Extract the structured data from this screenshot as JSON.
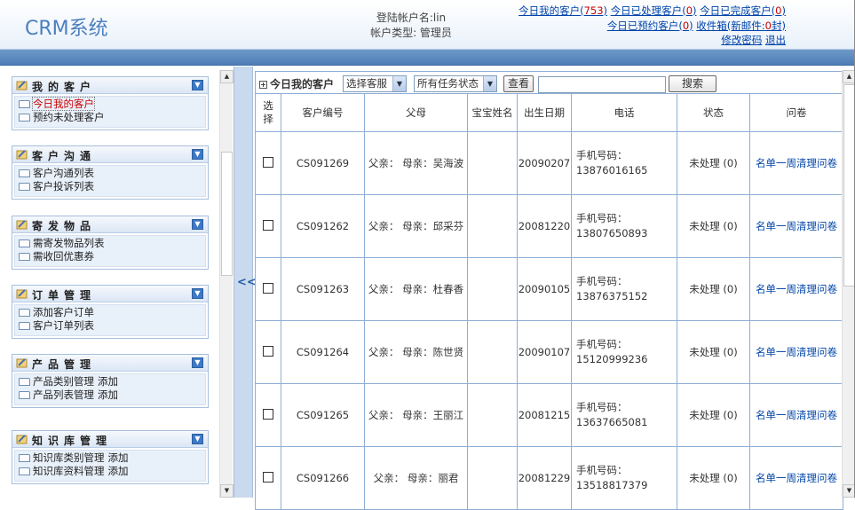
{
  "app": {
    "title": "CRM系统"
  },
  "login": {
    "account_line": "登陆帐户名:lin",
    "type_line": "帐户类型: 管理员"
  },
  "top_links": {
    "today_customers": {
      "label": "今日我的客户",
      "count": "753"
    },
    "today_handled": {
      "label": "今日已处理客户",
      "count": "0"
    },
    "today_done": {
      "label": "今日已完成客户",
      "count": "0"
    },
    "today_booked": {
      "label": "今日已预约客户",
      "count": "0"
    },
    "inbox": {
      "label": "收件箱(新邮件:",
      "count": "0",
      "suffix": "封)"
    },
    "change_password": "修改密码",
    "logout": "退出"
  },
  "sidebar": {
    "panels": [
      {
        "title": "我的客户",
        "items": [
          {
            "label": "今日我的客户",
            "active": true
          },
          {
            "label": "预约未处理客户"
          }
        ]
      },
      {
        "title": "客户沟通",
        "items": [
          {
            "label": "客户沟通列表"
          },
          {
            "label": "客户投诉列表"
          }
        ]
      },
      {
        "title": "寄发物品",
        "items": [
          {
            "label": "需寄发物品列表"
          },
          {
            "label": "需收回优惠券"
          }
        ]
      },
      {
        "title": "订单管理",
        "items": [
          {
            "label": "添加客户订单"
          },
          {
            "label": "客户订单列表"
          }
        ]
      },
      {
        "title": "产品管理",
        "items": [
          {
            "label": "产品类别管理",
            "add": "添加"
          },
          {
            "label": "产品列表管理",
            "add": "添加"
          }
        ]
      },
      {
        "title": "知识库管理",
        "items": [
          {
            "label": "知识库类别管理",
            "add": "添加"
          },
          {
            "label": "知识库资料管理",
            "add": "添加"
          }
        ]
      }
    ],
    "collapse": "<<"
  },
  "toolbar": {
    "title": "今日我的客户",
    "select_service": "选择客服",
    "select_status": "所有任务状态",
    "view_button": "查看",
    "search_value": "",
    "search_button": "搜索"
  },
  "table": {
    "headers": [
      "选择",
      "客户编号",
      "父母",
      "宝宝姓名",
      "出生日期",
      "电话",
      "状态",
      "问卷"
    ],
    "rows": [
      {
        "id": "CS091269",
        "parents": "父亲： 母亲：吴海波",
        "baby": "",
        "birth": "20090207",
        "phone_label": "手机号码：",
        "phone": "13876016165",
        "status": "未处理 (0)",
        "survey": "名单一周清理问卷"
      },
      {
        "id": "CS091262",
        "parents": "父亲： 母亲：邱采芬",
        "baby": "",
        "birth": "20081220",
        "phone_label": "手机号码：",
        "phone": "13807650893",
        "status": "未处理 (0)",
        "survey": "名单一周清理问卷"
      },
      {
        "id": "CS091263",
        "parents": "父亲： 母亲：杜春香",
        "baby": "",
        "birth": "20090105",
        "phone_label": "手机号码：",
        "phone": "13876375152",
        "status": "未处理 (0)",
        "survey": "名单一周清理问卷"
      },
      {
        "id": "CS091264",
        "parents": "父亲： 母亲：陈世贤",
        "baby": "",
        "birth": "20090107",
        "phone_label": "手机号码：",
        "phone": "15120999236",
        "status": "未处理 (0)",
        "survey": "名单一周清理问卷"
      },
      {
        "id": "CS091265",
        "parents": "父亲： 母亲：王丽江",
        "baby": "",
        "birth": "20081215",
        "phone_label": "手机号码：",
        "phone": "13637665081",
        "status": "未处理 (0)",
        "survey": "名单一周清理问卷"
      },
      {
        "id": "CS091266",
        "parents": "父亲： 母亲：丽君",
        "baby": "",
        "birth": "20081229",
        "phone_label": "手机号码：",
        "phone": "13518817379",
        "status": "未处理 (0)",
        "survey": "名单一周清理问卷"
      }
    ]
  },
  "colors": {
    "brand": "#4b7fbf",
    "bar": "#5a88c0",
    "border": "#8eaed6",
    "count": "#cc0000"
  }
}
